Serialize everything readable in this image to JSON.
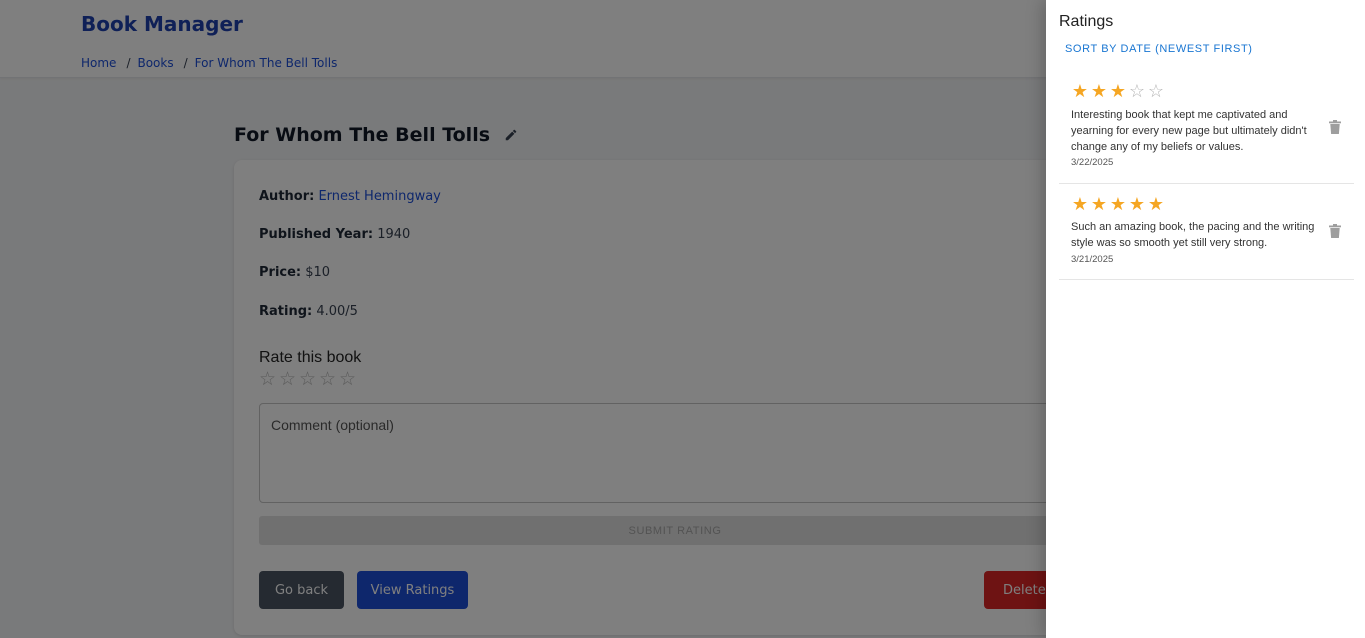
{
  "header": {
    "brand": "Book Manager",
    "breadcrumb": [
      "Home",
      "Books",
      "For Whom The Bell Tolls"
    ],
    "separator": "/"
  },
  "book": {
    "title": "For Whom The Bell Tolls",
    "author_label": "Author:",
    "author": "Ernest Hemingway",
    "year_label": "Published Year:",
    "year": "1940",
    "price_label": "Price:",
    "price": "$10",
    "rating_label": "Rating:",
    "rating": "4.00/5"
  },
  "rate_form": {
    "heading": "Rate this book",
    "comment_placeholder": "Comment (optional)",
    "submit_label": "SUBMIT RATING"
  },
  "actions": {
    "back": "Go back",
    "view_ratings": "View Ratings",
    "delete": "Delete Book"
  },
  "drawer": {
    "title": "Ratings",
    "sort_label": "SORT BY DATE (NEWEST FIRST)",
    "ratings": [
      {
        "stars": 3,
        "comment": "Interesting book that kept me captivated and yearning for every new page but ultimately didn't change any of my beliefs or values.",
        "date": "3/22/2025"
      },
      {
        "stars": 5,
        "comment": "Such an amazing book, the pacing and the writing style was so smooth yet still very strong.",
        "date": "3/21/2025"
      }
    ]
  },
  "colors": {
    "brand": "#1e40af",
    "link": "#1d4ed8",
    "star": "#f5a623",
    "delete": "#dc2626",
    "back": "#4b5563"
  }
}
